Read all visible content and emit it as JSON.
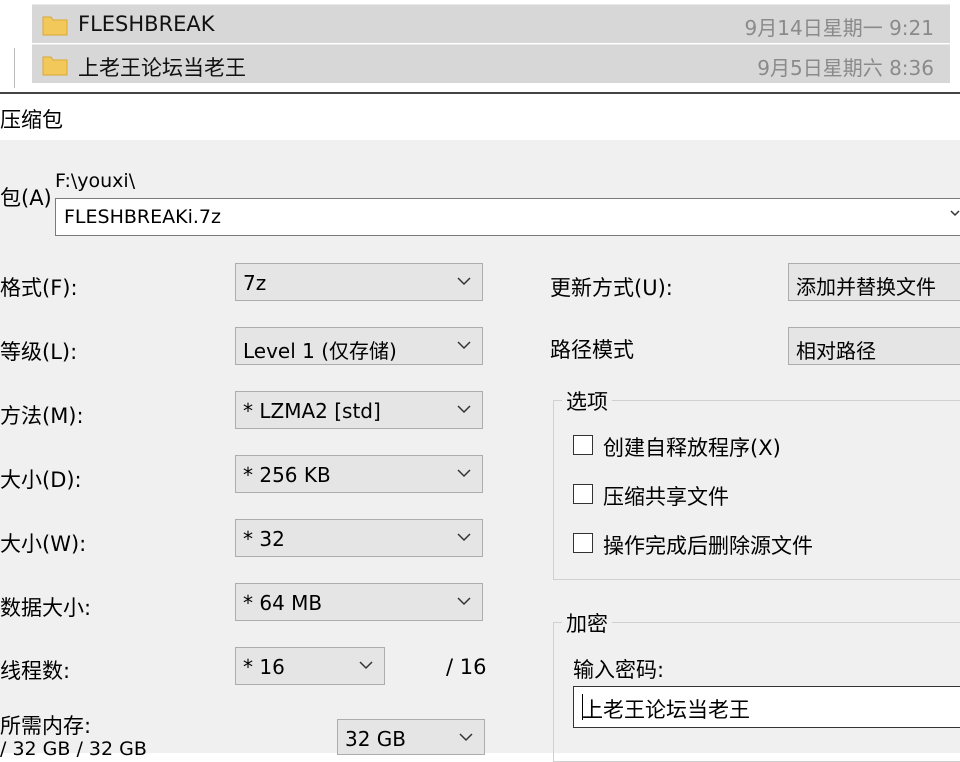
{
  "files": [
    {
      "name": "FLESHBREAK",
      "date": "9月14日星期一 9:21"
    },
    {
      "name": "上老王论坛当老王",
      "date": "9月5日星期六 8:36"
    }
  ],
  "dialog": {
    "title": "压缩包",
    "archive": {
      "label": "包(A)",
      "path": "F:\\youxi\\",
      "filename": "FLESHBREAKi.7z"
    },
    "left": [
      {
        "label": "格式(F):",
        "value": "7z"
      },
      {
        "label": "等级(L):",
        "value": "Level 1 (仅存储)"
      },
      {
        "label": "方法(M):",
        "value": "* LZMA2 [std]"
      },
      {
        "label": "大小(D):",
        "value": "* 256 KB"
      },
      {
        "label": "大小(W):",
        "value": "* 32"
      },
      {
        "label": "数据大小:",
        "value": "* 64 MB"
      },
      {
        "label": "线程数:",
        "value": "* 16"
      }
    ],
    "threads_total": "/ 16",
    "memory": {
      "label": "所需内存:",
      "value": "32 GB",
      "sub": "/ 32 GB / 32 GB"
    },
    "update_mode": {
      "label": "更新方式(U):",
      "value": "添加并替换文件"
    },
    "path_mode": {
      "label": "路径模式",
      "value": "相对路径"
    },
    "options": {
      "title": "选项",
      "items": [
        "创建自释放程序(X)",
        "压缩共享文件",
        "操作完成后删除源文件"
      ]
    },
    "encryption": {
      "title": "加密",
      "password_label": "输入密码:",
      "password_value": "上老王论坛当老王"
    }
  }
}
